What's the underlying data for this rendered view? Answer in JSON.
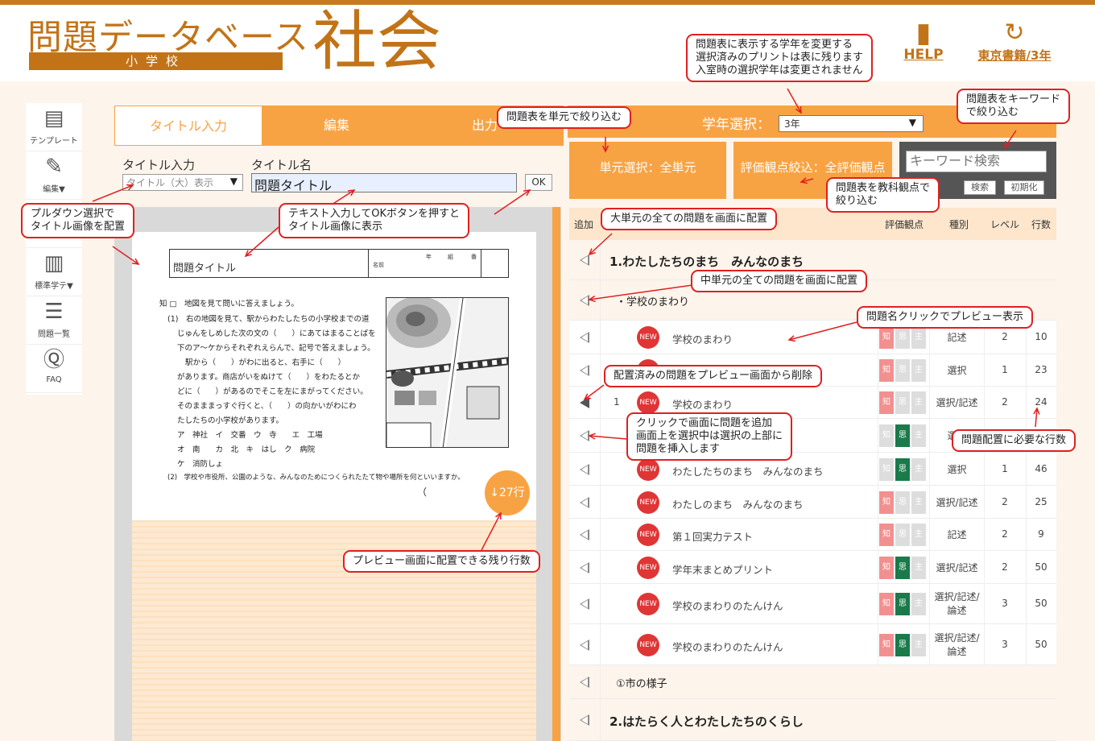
{
  "header": {
    "logo_title": "問題データベース",
    "logo_sub": "小学校",
    "subject": "社会",
    "help_label": "HELP",
    "publisher_grade": "東京書籍/3年"
  },
  "sidebar": {
    "items": [
      {
        "label": "テンプレート",
        "icon": "template-icon"
      },
      {
        "label": "編集▼",
        "icon": "edit-icon"
      },
      {
        "label": "",
        "icon": "blank"
      },
      {
        "label": "標準学テ▼",
        "icon": "chart-icon"
      },
      {
        "label": "問題一覧",
        "icon": "list-icon"
      },
      {
        "label": "FAQ",
        "icon": "faq-icon"
      }
    ]
  },
  "tabs": [
    "タイトル入力",
    "編集",
    "出力"
  ],
  "title_form": {
    "select_label": "タイトル入力",
    "select_value": "タイトル（大）表示",
    "name_label": "タイトル名",
    "name_value": "問題タイトル",
    "ok_label": "OK"
  },
  "preview": {
    "title": "問題タイトル",
    "name_field": "名前",
    "grade_cols": [
      "年",
      "組",
      "番"
    ],
    "question_head": "地図を見て問いに答えましょう。",
    "lines": [
      "(1)　右の地図を見て、駅からわたしたちの小学校までの道",
      "じゅんをしめした次の文の（　　）にあてはまることばを",
      "下のア〜ケからそれぞれえらんで、記号で答えましょう。",
      "駅から（　　）がわに出ると、右手に（　　）",
      "があります。商店がいをぬけて（　　）をわたるとか",
      "どに（　　）があるのでそこを左にまがってください。",
      "そのまままっすぐ行くと、（　　）の向かいがわにわ",
      "たしたちの小学校があります。"
    ],
    "choices": [
      [
        "ア　神社",
        "イ　交番",
        "ウ　寺",
        "エ　工場"
      ],
      [
        "オ　南",
        "カ　北",
        "キ　はし",
        "ク　病院"
      ],
      [
        "ケ　消防しょ"
      ]
    ],
    "q2": "(2)　学校や市役所、公園のような、みんなのためにつくられたたて物や場所を何といいますか。",
    "q2_paren": "（",
    "remaining_rows": "↓27行"
  },
  "right": {
    "grade_label": "学年選択：",
    "grade_value": "3年",
    "unit_filter": "単元選択：全単元",
    "view_filter": "評価観点絞込：全評価観点",
    "keyword_placeholder": "キーワード検索",
    "search_btn": "検索",
    "reset_btn": "初期化",
    "table_headers": {
      "add": "追加",
      "view": "評価観点",
      "kind": "種別",
      "level": "レベル",
      "lines": "行数"
    },
    "rows": [
      {
        "type": "unit-big",
        "label": "1.わたしたちのまち　みんなのまち"
      },
      {
        "type": "unit-mid",
        "label": "・学校のまわり"
      },
      {
        "type": "q",
        "num": "",
        "name": "学校のまわり",
        "k": true,
        "s": false,
        "kind": "記述",
        "level": "2",
        "lines": "10"
      },
      {
        "type": "q",
        "num": "",
        "name": "",
        "k": true,
        "s": false,
        "kind": "選択",
        "level": "1",
        "lines": "23"
      },
      {
        "type": "q",
        "num": "1",
        "name": "学校のまわり",
        "k": true,
        "s": false,
        "kind": "選択/記述",
        "level": "2",
        "lines": "24",
        "placed": true
      },
      {
        "type": "q",
        "num": "",
        "name": "",
        "k": false,
        "s": true,
        "kind": "選択",
        "level": "",
        "lines": ""
      },
      {
        "type": "q",
        "num": "",
        "name": "わたしたちのまち　みんなのまち",
        "k": false,
        "s": true,
        "kind": "選択",
        "level": "1",
        "lines": "46"
      },
      {
        "type": "q",
        "num": "",
        "name": "わたしのまち　みんなのまち",
        "k": true,
        "s": false,
        "kind": "選択/記述",
        "level": "2",
        "lines": "25"
      },
      {
        "type": "q",
        "num": "",
        "name": "第１回実力テスト",
        "k": true,
        "s": false,
        "kind": "記述",
        "level": "2",
        "lines": "9"
      },
      {
        "type": "q",
        "num": "",
        "name": "学年末まとめプリント",
        "k": true,
        "s": true,
        "kind": "選択/記述",
        "level": "2",
        "lines": "50"
      },
      {
        "type": "q",
        "num": "",
        "name": "学校のまわりのたんけん",
        "k": true,
        "s": true,
        "kind": "選択/記述/論述",
        "level": "3",
        "lines": "50"
      },
      {
        "type": "q",
        "num": "",
        "name": "学校のまわりのたんけん",
        "k": true,
        "s": true,
        "kind": "選択/記述/論述",
        "level": "3",
        "lines": "50"
      },
      {
        "type": "unit-mid",
        "label": "①市の様子"
      },
      {
        "type": "unit-big",
        "label": "2.はたらく人とわたしたちのくらし"
      }
    ],
    "view_letters": [
      "知",
      "思",
      "主"
    ],
    "new_badge": "NEW"
  },
  "callouts": {
    "grade_note": "問題表に表示する学年を変更する\n選択済みのプリントは表に残ります\n入室時の選択学年は変更されません",
    "unit_filter_note": "問題表を単元で絞り込む",
    "keyword_note": "問題表をキーワード\nで絞り込む",
    "view_note": "問題表を教科観点で\n絞り込む",
    "pulldown_note": "プルダウン選択で\nタイトル画像を配置",
    "text_note": "テキスト入力してOKボタンを押すと\nタイトル画像に表示",
    "big_unit_note": "大単元の全ての問題を画面に配置",
    "mid_unit_note": "中単元の全ての問題を画面に配置",
    "preview_note": "問題名クリックでプレビュー表示",
    "delete_note": "配置済みの問題をプレビュー画面から削除",
    "add_note": "クリックで画面に問題を追加\n画面上を選択中は選択の上部に\n問題を挿入します",
    "lines_note": "問題配置に必要な行数",
    "remaining_note": "プレビュー画面に配置できる残り行数"
  }
}
